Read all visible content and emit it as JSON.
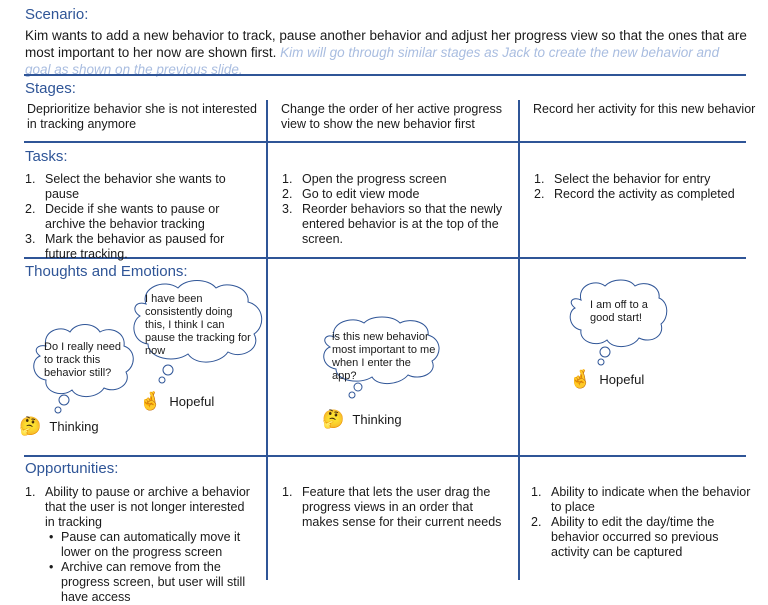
{
  "scenario": {
    "heading": "Scenario:",
    "text": "Kim wants to add a new behavior to track, pause another behavior and adjust her progress view so that the ones that are most important to her now are shown first. ",
    "note": "Kim will go through similar stages as Jack to create the new behavior and goal as shown on the previous slide."
  },
  "stages": {
    "heading": "Stages:",
    "items": [
      "Deprioritize behavior she is not interested in tracking anymore",
      "Change the order of her active progress view to show the new behavior first",
      "Record her activity for this new behavior"
    ]
  },
  "tasks": {
    "heading": "Tasks:",
    "columns": [
      [
        "Select the behavior she wants to pause",
        "Decide if she wants to pause or archive the behavior tracking",
        "Mark the behavior as paused for future tracking."
      ],
      [
        "Open the progress screen",
        "Go to edit view mode",
        "Reorder behaviors so that the newly entered behavior is at the top of the screen."
      ],
      [
        "Select the behavior for entry",
        "Record the activity as completed"
      ]
    ]
  },
  "thoughts": {
    "heading": "Thoughts and Emotions:",
    "col1": {
      "bubble_a": "Do I really need to track this behavior still?",
      "bubble_b": "I have been consistently doing this, I think I can pause the tracking for now",
      "emotion_a": "Thinking",
      "emotion_b": "Hopeful"
    },
    "col2": {
      "bubble": "is this new behavior most important to me when I enter the app?",
      "emotion": "Thinking"
    },
    "col3": {
      "bubble": "I am off to a good start!",
      "emotion": "Hopeful"
    }
  },
  "opportunities": {
    "heading": "Opportunities:",
    "col1": {
      "item": "Ability to pause or archive a behavior that the user is not longer interested in tracking",
      "sub": [
        "Pause can automatically move it lower on the progress screen",
        "Archive can remove from the progress screen, but user will still have access"
      ]
    },
    "col2": [
      "Feature that lets the user drag the progress views in an order that makes sense for their current needs"
    ],
    "col3": [
      "Ability to indicate when the behavior to place",
      "Ability to edit the day/time the behavior occurred so previous activity can be captured"
    ]
  },
  "icons": {
    "thinking": "thinking-face-icon",
    "hopeful": "crossed-fingers-icon"
  },
  "colors": {
    "accent": "#2f5597",
    "faded": "#a9bde0"
  }
}
